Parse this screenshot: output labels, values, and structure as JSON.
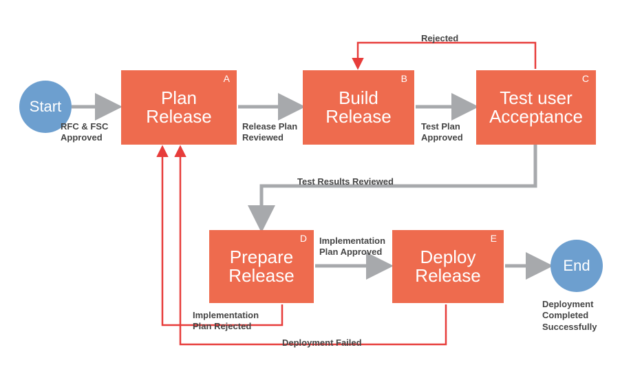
{
  "nodes": {
    "start": {
      "label": "Start"
    },
    "end": {
      "label": "End"
    },
    "A": {
      "tag": "A",
      "title_l1": "Plan",
      "title_l2": "Release"
    },
    "B": {
      "tag": "B",
      "title_l1": "Build",
      "title_l2": "Release"
    },
    "C": {
      "tag": "C",
      "title_l1": "Test user",
      "title_l2": "Acceptance"
    },
    "D": {
      "tag": "D",
      "title_l1": "Prepare",
      "title_l2": "Release"
    },
    "E": {
      "tag": "E",
      "title_l1": "Deploy",
      "title_l2": "Release"
    }
  },
  "edges": {
    "start_A": {
      "l1": "RFC & FSC",
      "l2": "Approved"
    },
    "A_B": {
      "l1": "Release Plan",
      "l2": "Reviewed"
    },
    "B_C": {
      "l1": "Test Plan",
      "l2": "Approved"
    },
    "C_B_rej": {
      "l1": "Rejected",
      "l2": ""
    },
    "C_D": {
      "l1": "Test Results Reviewed",
      "l2": ""
    },
    "D_E": {
      "l1": "Implementation",
      "l2": "Plan Approved"
    },
    "D_A_rej": {
      "l1": "Implementation",
      "l2": "Plan Rejected"
    },
    "E_A_fail": {
      "l1": "Deployment Failed",
      "l2": ""
    },
    "E_end": {
      "l1": "Deployment",
      "l2": "Completed",
      "l3": "Successfully"
    }
  },
  "colors": {
    "box": "#ee6b4e",
    "circle": "#6d9fcf",
    "arrow_gray": "#a7a9ac",
    "arrow_red": "#e73c3a"
  }
}
